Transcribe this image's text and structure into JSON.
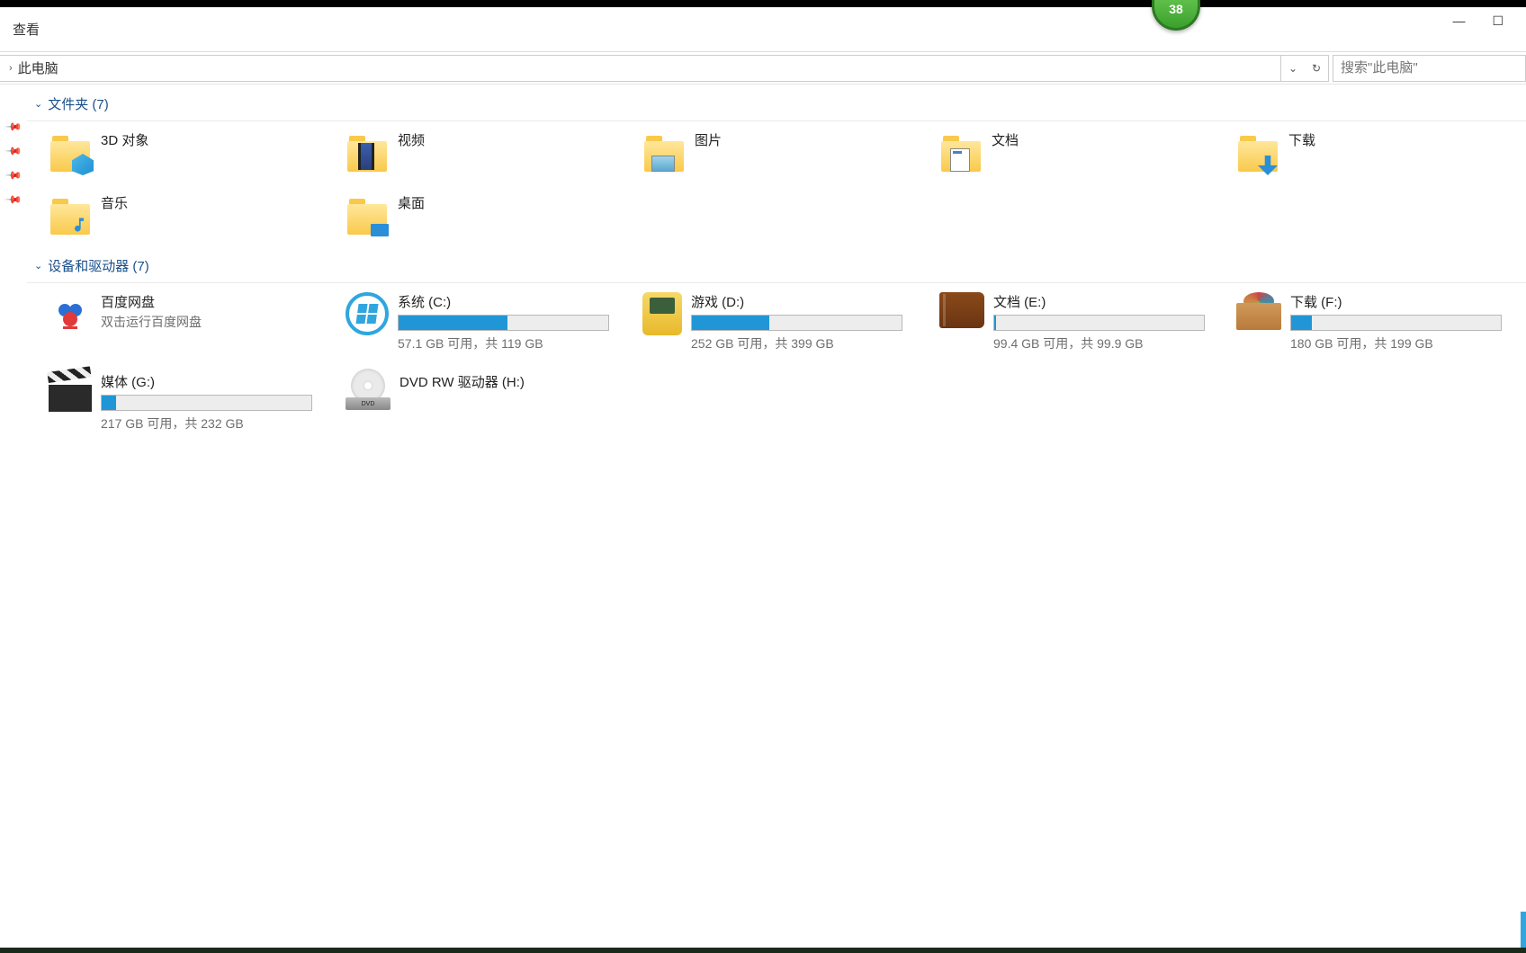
{
  "badge": "38",
  "ribbon": {
    "view_tab": "查看"
  },
  "breadcrumb": {
    "location": "此电脑"
  },
  "search": {
    "placeholder": "搜索\"此电脑\""
  },
  "sections": {
    "folders": {
      "header": "文件夹 (7)"
    },
    "devices": {
      "header": "设备和驱动器 (7)"
    }
  },
  "folders": [
    {
      "name": "3D 对象"
    },
    {
      "name": "视频"
    },
    {
      "name": "图片"
    },
    {
      "name": "文档"
    },
    {
      "name": "下载"
    },
    {
      "name": "音乐"
    },
    {
      "name": "桌面"
    }
  ],
  "devices": {
    "baidu": {
      "name": "百度网盘",
      "sub": "双击运行百度网盘"
    },
    "c": {
      "name": "系统 (C:)",
      "sub": "57.1 GB 可用，共 119 GB",
      "fill": 52
    },
    "d": {
      "name": "游戏 (D:)",
      "sub": "252 GB 可用，共 399 GB",
      "fill": 37
    },
    "e": {
      "name": "文档 (E:)",
      "sub": "99.4 GB 可用，共 99.9 GB",
      "fill": 1
    },
    "f": {
      "name": "下载 (F:)",
      "sub": "180 GB 可用，共 199 GB",
      "fill": 10
    },
    "g": {
      "name": "媒体 (G:)",
      "sub": "217 GB 可用，共 232 GB",
      "fill": 7
    },
    "h": {
      "name": "DVD RW 驱动器 (H:)"
    }
  }
}
